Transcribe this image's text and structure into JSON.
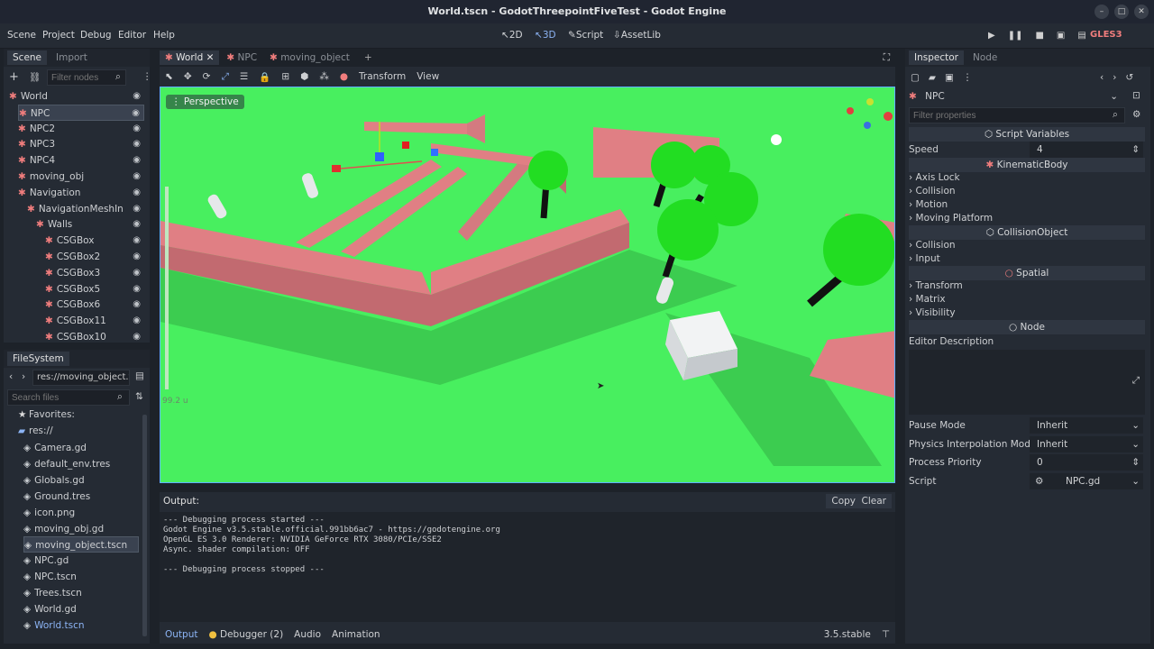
{
  "window": {
    "title": "World.tscn - GodotThreepointFiveTest - Godot Engine"
  },
  "menus": [
    "Scene",
    "Project",
    "Debug",
    "Editor",
    "Help"
  ],
  "workspaces": [
    {
      "label": "2D"
    },
    {
      "label": "3D"
    },
    {
      "label": "Script"
    },
    {
      "label": "AssetLib"
    }
  ],
  "renderer": "GLES3",
  "scene_dock": {
    "tabs": [
      "Scene",
      "Import"
    ],
    "filter_placeholder": "Filter nodes",
    "nodes": [
      {
        "label": "World",
        "depth": 0,
        "color": "#f07d7d"
      },
      {
        "label": "NPC",
        "depth": 1,
        "color": "#f07d7d",
        "selected": true
      },
      {
        "label": "NPC2",
        "depth": 1,
        "color": "#f07d7d"
      },
      {
        "label": "NPC3",
        "depth": 1,
        "color": "#f07d7d"
      },
      {
        "label": "NPC4",
        "depth": 1,
        "color": "#f07d7d"
      },
      {
        "label": "moving_obj",
        "depth": 1,
        "color": "#f07d7d"
      },
      {
        "label": "Navigation",
        "depth": 1,
        "color": "#f07d7d"
      },
      {
        "label": "NavigationMeshIn",
        "depth": 2,
        "color": "#f07d7d"
      },
      {
        "label": "Walls",
        "depth": 3,
        "color": "#f07d7d"
      },
      {
        "label": "CSGBox",
        "depth": 4,
        "color": "#f07d7d"
      },
      {
        "label": "CSGBox2",
        "depth": 4,
        "color": "#f07d7d"
      },
      {
        "label": "CSGBox3",
        "depth": 4,
        "color": "#f07d7d"
      },
      {
        "label": "CSGBox5",
        "depth": 4,
        "color": "#f07d7d"
      },
      {
        "label": "CSGBox6",
        "depth": 4,
        "color": "#f07d7d"
      },
      {
        "label": "CSGBox11",
        "depth": 4,
        "color": "#f07d7d"
      },
      {
        "label": "CSGBox10",
        "depth": 4,
        "color": "#f07d7d"
      }
    ]
  },
  "filesystem": {
    "tab": "FileSystem",
    "path": "res://moving_object.ts",
    "search_placeholder": "Search files",
    "favorites": "Favorites:",
    "root": "res://",
    "files": [
      "Camera.gd",
      "default_env.tres",
      "Globals.gd",
      "Ground.tres",
      "icon.png",
      "moving_obj.gd",
      "moving_object.tscn",
      "NPC.gd",
      "NPC.tscn",
      "Trees.tscn",
      "World.gd",
      "World.tscn"
    ]
  },
  "editor_tabs": [
    {
      "label": "World",
      "active": true
    },
    {
      "label": "NPC"
    },
    {
      "label": "moving_object"
    }
  ],
  "viewport": {
    "toolbar": [
      "Transform",
      "View"
    ],
    "perspective": "Perspective",
    "distance": "99.2 u"
  },
  "output": {
    "title": "Output:",
    "copy": "Copy",
    "clear": "Clear",
    "lines": [
      "--- Debugging process started ---",
      "Godot Engine v3.5.stable.official.991bb6ac7 - https://godotengine.org",
      "OpenGL ES 3.0 Renderer: NVIDIA GeForce RTX 3080/PCIe/SSE2",
      "Async. shader compilation: OFF",
      "",
      "--- Debugging process stopped ---"
    ]
  },
  "bottom_tabs": [
    {
      "label": "Output",
      "active": true
    },
    {
      "label": "Debugger (2)"
    },
    {
      "label": "Audio"
    },
    {
      "label": "Animation"
    }
  ],
  "version": "3.5.stable",
  "inspector": {
    "tabs": [
      "Inspector",
      "Node"
    ],
    "node_name": "NPC",
    "filter_placeholder": "Filter properties",
    "script_variables": "Script Variables",
    "speed_label": "Speed",
    "speed_value": "4",
    "kinematic": "KinematicBody",
    "kinematic_items": [
      "Axis Lock",
      "Collision",
      "Motion",
      "Moving Platform"
    ],
    "collision_object": "CollisionObject",
    "collision_items": [
      "Collision",
      "Input"
    ],
    "spatial": "Spatial",
    "spatial_items": [
      "Transform",
      "Matrix",
      "Visibility"
    ],
    "node": "Node",
    "editor_description": "Editor Description",
    "pause_mode_label": "Pause Mode",
    "pause_mode_value": "Inherit",
    "physics_interp_label": "Physics Interpolation Mode",
    "physics_interp_value": "Inherit",
    "process_priority_label": "Process Priority",
    "process_priority_value": "0",
    "script_label": "Script",
    "script_value": "NPC.gd"
  }
}
